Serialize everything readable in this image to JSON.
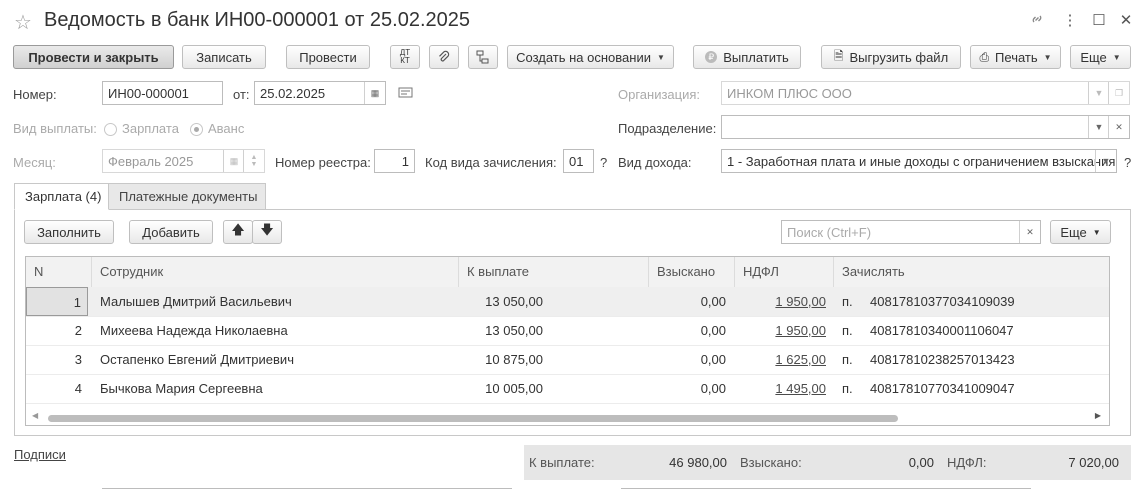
{
  "window": {
    "title": "Ведомость в банк ИН00-000001 от 25.02.2025"
  },
  "toolbar": {
    "post_close": "Провести и закрыть",
    "save": "Записать",
    "post": "Провести",
    "dt_kt": "ДТ\nКТ",
    "create_based": "Создать на основании",
    "pay": "Выплатить",
    "export": "Выгрузить файл",
    "print": "Печать",
    "more": "Еще"
  },
  "form": {
    "number_label": "Номер:",
    "number_value": "ИН00-000001",
    "date_label": "от:",
    "date_value": "25.02.2025",
    "org_label": "Организация:",
    "org_value": "ИНКОМ ПЛЮС ООО",
    "payment_type_label": "Вид выплаты:",
    "payment_options": [
      "Зарплата",
      "Аванс"
    ],
    "payment_selected": "Аванс",
    "dept_label": "Подразделение:",
    "dept_value": "",
    "month_label": "Месяц:",
    "month_value": "Февраль 2025",
    "registry_label": "Номер реестра:",
    "registry_value": "1",
    "accrual_label": "Код вида зачисления:",
    "accrual_value": "01",
    "income_label": "Вид дохода:",
    "income_value": "1 - Заработная плата и иные доходы с ограничением взыскания",
    "help": "?"
  },
  "tabs": [
    {
      "label": "Зарплата (4)",
      "active": true
    },
    {
      "label": "Платежные документы",
      "active": false
    }
  ],
  "table_toolbar": {
    "fill": "Заполнить",
    "add": "Добавить",
    "search_placeholder": "Поиск (Ctrl+F)",
    "more": "Еще"
  },
  "table": {
    "columns": [
      "N",
      "Сотрудник",
      "К выплате",
      "Взыскано",
      "НДФЛ",
      "Зачислять"
    ],
    "rows": [
      {
        "n": "1",
        "employee": "Малышев Дмитрий Васильевич",
        "to_pay": "13 050,00",
        "collected": "0,00",
        "ndfl": "1 950,00",
        "abbr": "п.",
        "account": "40817810377034109039"
      },
      {
        "n": "2",
        "employee": "Михеева Надежда Николаевна",
        "to_pay": "13 050,00",
        "collected": "0,00",
        "ndfl": "1 950,00",
        "abbr": "п.",
        "account": "40817810340001106047"
      },
      {
        "n": "3",
        "employee": "Остапенко Евгений Дмитриевич",
        "to_pay": "10 875,00",
        "collected": "0,00",
        "ndfl": "1 625,00",
        "abbr": "п.",
        "account": "40817810238257013423"
      },
      {
        "n": "4",
        "employee": "Бычкова Мария Сергеевна",
        "to_pay": "10 005,00",
        "collected": "0,00",
        "ndfl": "1 495,00",
        "abbr": "п.",
        "account": "40817810770341009047"
      }
    ]
  },
  "footer": {
    "signatures": "Подписи",
    "to_pay_label": "К выплате:",
    "to_pay_value": "46 980,00",
    "collected_label": "Взыскано:",
    "collected_value": "0,00",
    "ndfl_label": "НДФЛ:",
    "ndfl_value": "7 020,00"
  }
}
